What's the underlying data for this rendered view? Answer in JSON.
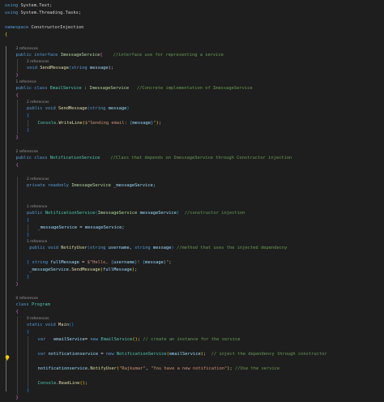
{
  "editor": {
    "colors": {
      "background": "#1e1e1e",
      "kw": "#569cd6",
      "ctl": "#c586c0",
      "type": "#4ec9b0",
      "iface": "#b8d7a3",
      "method": "#dcdcaa",
      "var": "#9cdcfe",
      "str": "#ce9178",
      "cmt": "#6a9955",
      "plain": "#d4d4d4",
      "codelens": "#999999",
      "lightbulb": "#ffcc00"
    },
    "lightbulb_icon": "lightbulb-icon",
    "lines": [
      {
        "type": "code",
        "indent": 0,
        "tokens": [
          {
            "t": "using ",
            "c": "dim"
          },
          {
            "t": "System.Linq;",
            "c": "dim"
          }
        ]
      },
      {
        "type": "code",
        "indent": 0,
        "tokens": [
          {
            "t": "using ",
            "c": "kw"
          },
          {
            "t": "System.Text;",
            "c": "ns"
          }
        ]
      },
      {
        "type": "code",
        "indent": 0,
        "tokens": [
          {
            "t": "using ",
            "c": "kw"
          },
          {
            "t": "System.Threading.Tasks;",
            "c": "ns"
          }
        ]
      },
      {
        "type": "blank"
      },
      {
        "type": "code",
        "indent": 0,
        "tokens": [
          {
            "t": "namespace ",
            "c": "kw"
          },
          {
            "t": "ConstructorInjection",
            "c": "ns"
          }
        ]
      },
      {
        "type": "code",
        "indent": 0,
        "tokens": [
          {
            "t": "{",
            "c": "brk1"
          }
        ]
      },
      {
        "type": "blank"
      },
      {
        "type": "lens",
        "indent": 1,
        "text": "3 references"
      },
      {
        "type": "code",
        "indent": 1,
        "tokens": [
          {
            "t": "public ",
            "c": "kw"
          },
          {
            "t": "interface ",
            "c": "kw"
          },
          {
            "t": "ImessageService",
            "c": "iface"
          },
          {
            "t": "{",
            "c": "brk2"
          },
          {
            "t": "    //interface use for representing a service",
            "c": "cmt"
          }
        ]
      },
      {
        "type": "lens",
        "indent": 2,
        "text": "2 references"
      },
      {
        "type": "code",
        "indent": 2,
        "tokens": [
          {
            "t": "void ",
            "c": "kw"
          },
          {
            "t": "SendMessage",
            "c": "method"
          },
          {
            "t": "(",
            "c": "brk3"
          },
          {
            "t": "string ",
            "c": "kw"
          },
          {
            "t": "message",
            "c": "var"
          },
          {
            "t": ");",
            "c": "plain"
          }
        ]
      },
      {
        "type": "code",
        "indent": 1,
        "tokens": [
          {
            "t": "}",
            "c": "brk2"
          }
        ]
      },
      {
        "type": "lens",
        "indent": 1,
        "text": "1 reference"
      },
      {
        "type": "code",
        "indent": 1,
        "tokens": [
          {
            "t": "public ",
            "c": "kw"
          },
          {
            "t": "class ",
            "c": "kw"
          },
          {
            "t": "EmailService",
            "c": "type"
          },
          {
            "t": " : ",
            "c": "plain"
          },
          {
            "t": "ImessageService",
            "c": "iface"
          },
          {
            "t": "   //Concrete implementation of ImessageService",
            "c": "cmt"
          }
        ]
      },
      {
        "type": "code",
        "indent": 1,
        "tokens": [
          {
            "t": "{",
            "c": "brk2"
          }
        ]
      },
      {
        "type": "lens",
        "indent": 2,
        "text": "2 references"
      },
      {
        "type": "code",
        "indent": 2,
        "tokens": [
          {
            "t": "public ",
            "c": "kw"
          },
          {
            "t": "void ",
            "c": "kw"
          },
          {
            "t": "SendMessage",
            "c": "method"
          },
          {
            "t": "(",
            "c": "brk3"
          },
          {
            "t": "string ",
            "c": "kw"
          },
          {
            "t": "message",
            "c": "var"
          },
          {
            "t": ")",
            "c": "brk3"
          }
        ]
      },
      {
        "type": "code",
        "indent": 2,
        "tokens": [
          {
            "t": "{",
            "c": "brk3"
          }
        ]
      },
      {
        "type": "code",
        "indent": 3,
        "tokens": [
          {
            "t": "Console",
            "c": "type"
          },
          {
            "t": ".",
            "c": "plain"
          },
          {
            "t": "WriteLine",
            "c": "method"
          },
          {
            "t": "(",
            "c": "brk1"
          },
          {
            "t": "$\"Sending email: ",
            "c": "str"
          },
          {
            "t": "{",
            "c": "kw"
          },
          {
            "t": "message",
            "c": "var"
          },
          {
            "t": "}",
            "c": "kw"
          },
          {
            "t": "\"",
            "c": "str"
          },
          {
            "t": ")",
            "c": "brk1"
          },
          {
            "t": ";",
            "c": "plain"
          }
        ]
      },
      {
        "type": "code",
        "indent": 2,
        "tokens": [
          {
            "t": "}",
            "c": "brk3"
          }
        ]
      },
      {
        "type": "code",
        "indent": 1,
        "tokens": [
          {
            "t": "}",
            "c": "brk2"
          }
        ]
      },
      {
        "type": "blank"
      },
      {
        "type": "lens",
        "indent": 1,
        "text": "2 references"
      },
      {
        "type": "code",
        "indent": 1,
        "tokens": [
          {
            "t": "public ",
            "c": "kw"
          },
          {
            "t": "class ",
            "c": "kw"
          },
          {
            "t": "NotificationService",
            "c": "type"
          },
          {
            "t": "    //Class that depends on ImessageService through Constructor injection",
            "c": "cmt"
          }
        ]
      },
      {
        "type": "code",
        "indent": 1,
        "tokens": [
          {
            "t": "{",
            "c": "brk2"
          }
        ]
      },
      {
        "type": "blank"
      },
      {
        "type": "lens",
        "indent": 2,
        "text": "2 references"
      },
      {
        "type": "code",
        "indent": 2,
        "tokens": [
          {
            "t": "private ",
            "c": "kw"
          },
          {
            "t": "readonly ",
            "c": "kw"
          },
          {
            "t": "ImessageService",
            "c": "iface"
          },
          {
            "t": " _messageService;",
            "c": "var"
          }
        ]
      },
      {
        "type": "blank"
      },
      {
        "type": "blank"
      },
      {
        "type": "lens",
        "indent": 2,
        "text": "1 reference"
      },
      {
        "type": "code",
        "indent": 2,
        "tokens": [
          {
            "t": "public ",
            "c": "kw"
          },
          {
            "t": "NotificationService",
            "c": "type"
          },
          {
            "t": "(",
            "c": "brk3"
          },
          {
            "t": "ImessageService ",
            "c": "iface"
          },
          {
            "t": "messageService",
            "c": "var"
          },
          {
            "t": ")",
            "c": "brk3"
          },
          {
            "t": "  //constructor injection",
            "c": "cmt"
          }
        ]
      },
      {
        "type": "code",
        "indent": 2,
        "tokens": [
          {
            "t": "{",
            "c": "brk3"
          }
        ]
      },
      {
        "type": "code",
        "indent": 3,
        "tokens": [
          {
            "t": "_messageService",
            "c": "var"
          },
          {
            "t": " = ",
            "c": "plain"
          },
          {
            "t": "messageService",
            "c": "var"
          },
          {
            "t": ";",
            "c": "plain"
          }
        ]
      },
      {
        "type": "code",
        "indent": 2,
        "tokens": [
          {
            "t": "}",
            "c": "brk3"
          }
        ]
      },
      {
        "type": "lens",
        "indent": 2,
        "text": "1 reference"
      },
      {
        "type": "code",
        "indent": 2,
        "tokens": [
          {
            "t": " public ",
            "c": "kw"
          },
          {
            "t": "void ",
            "c": "kw"
          },
          {
            "t": "NotifyUser",
            "c": "method"
          },
          {
            "t": "(",
            "c": "brk3"
          },
          {
            "t": "string ",
            "c": "kw"
          },
          {
            "t": "username",
            "c": "var"
          },
          {
            "t": ", ",
            "c": "plain"
          },
          {
            "t": "string ",
            "c": "kw"
          },
          {
            "t": "message",
            "c": "var"
          },
          {
            "t": ")",
            "c": "brk3"
          },
          {
            "t": " //method that uses the injected dependecny",
            "c": "cmt"
          }
        ]
      },
      {
        "type": "blank"
      },
      {
        "type": "code",
        "indent": 2,
        "tokens": [
          {
            "t": "{",
            "c": "brk3"
          },
          {
            "t": " string ",
            "c": "kw"
          },
          {
            "t": "fullMessage",
            "c": "var"
          },
          {
            "t": " = ",
            "c": "plain"
          },
          {
            "t": "$\"Hello, ",
            "c": "str"
          },
          {
            "t": "{",
            "c": "kw"
          },
          {
            "t": "username",
            "c": "var"
          },
          {
            "t": "}",
            "c": "kw"
          },
          {
            "t": "! ",
            "c": "str"
          },
          {
            "t": "{",
            "c": "kw"
          },
          {
            "t": "message",
            "c": "var"
          },
          {
            "t": "}",
            "c": "kw"
          },
          {
            "t": "\"",
            "c": "str"
          },
          {
            "t": ";",
            "c": "plain"
          }
        ]
      },
      {
        "type": "code",
        "indent": 2,
        "tokens": [
          {
            "t": " _messageService",
            "c": "var"
          },
          {
            "t": ".",
            "c": "plain"
          },
          {
            "t": "SendMessage",
            "c": "method"
          },
          {
            "t": "(",
            "c": "brk1"
          },
          {
            "t": "fullMessage",
            "c": "var"
          },
          {
            "t": ")",
            "c": "brk1"
          },
          {
            "t": ";",
            "c": "plain"
          }
        ]
      },
      {
        "type": "code",
        "indent": 2,
        "tokens": [
          {
            "t": "}",
            "c": "brk3"
          }
        ]
      },
      {
        "type": "code",
        "indent": 1,
        "tokens": [
          {
            "t": "}",
            "c": "brk2"
          }
        ]
      },
      {
        "type": "blank"
      },
      {
        "type": "lens",
        "indent": 1,
        "text": "0 references"
      },
      {
        "type": "code",
        "indent": 1,
        "tokens": [
          {
            "t": "class ",
            "c": "kw"
          },
          {
            "t": "Program",
            "c": "type"
          }
        ]
      },
      {
        "type": "code",
        "indent": 1,
        "tokens": [
          {
            "t": "{",
            "c": "brk2"
          }
        ]
      },
      {
        "type": "lens",
        "indent": 2,
        "text": "0 references"
      },
      {
        "type": "code",
        "indent": 2,
        "tokens": [
          {
            "t": "static ",
            "c": "kw"
          },
          {
            "t": "void ",
            "c": "kw"
          },
          {
            "t": "Main",
            "c": "method"
          },
          {
            "t": "()",
            "c": "brk3"
          }
        ]
      },
      {
        "type": "code",
        "indent": 2,
        "tokens": [
          {
            "t": "{",
            "c": "brk3"
          }
        ]
      },
      {
        "type": "code",
        "indent": 3,
        "tokens": [
          {
            "t": "var ",
            "c": "kw"
          },
          {
            "t": "  emailService",
            "c": "var"
          },
          {
            "t": "= ",
            "c": "plain"
          },
          {
            "t": "new ",
            "c": "kw"
          },
          {
            "t": "EmailService",
            "c": "type"
          },
          {
            "t": "()",
            "c": "brk1"
          },
          {
            "t": "; ",
            "c": "plain"
          },
          {
            "t": "// create an instance for the service",
            "c": "cmt"
          }
        ]
      },
      {
        "type": "blank"
      },
      {
        "type": "code",
        "indent": 3,
        "tokens": [
          {
            "t": "var ",
            "c": "kw"
          },
          {
            "t": "notificationservice",
            "c": "var"
          },
          {
            "t": " = ",
            "c": "plain"
          },
          {
            "t": "new ",
            "c": "kw"
          },
          {
            "t": "NotificationService",
            "c": "type"
          },
          {
            "t": "(",
            "c": "brk1"
          },
          {
            "t": "emailService",
            "c": "var"
          },
          {
            "t": ")",
            "c": "brk1"
          },
          {
            "t": ";  ",
            "c": "plain"
          },
          {
            "t": "// inject the dependency through constructor",
            "c": "cmt"
          }
        ]
      },
      {
        "type": "blank"
      },
      {
        "type": "code",
        "indent": 3,
        "tokens": [
          {
            "t": "notificationservice",
            "c": "var"
          },
          {
            "t": ".",
            "c": "plain"
          },
          {
            "t": "NotifyUser",
            "c": "method"
          },
          {
            "t": "(",
            "c": "brk1"
          },
          {
            "t": "\"Rajkumar\"",
            "c": "str"
          },
          {
            "t": ", ",
            "c": "plain"
          },
          {
            "t": "\"You have a new notification\"",
            "c": "str"
          },
          {
            "t": ")",
            "c": "brk1"
          },
          {
            "t": "; ",
            "c": "plain"
          },
          {
            "t": "//Use the service",
            "c": "cmt"
          }
        ]
      },
      {
        "type": "blank"
      },
      {
        "type": "code",
        "indent": 3,
        "tokens": [
          {
            "t": "Console",
            "c": "type"
          },
          {
            "t": ".",
            "c": "plain"
          },
          {
            "t": "ReadLine",
            "c": "method"
          },
          {
            "t": "()",
            "c": "brk1"
          },
          {
            "t": ";",
            "c": "plain"
          }
        ]
      },
      {
        "type": "code",
        "indent": 2,
        "tokens": [
          {
            "t": "}",
            "c": "brk3"
          }
        ]
      },
      {
        "type": "code",
        "indent": 1,
        "tokens": [
          {
            "t": "}",
            "c": "brk2"
          }
        ]
      }
    ]
  }
}
